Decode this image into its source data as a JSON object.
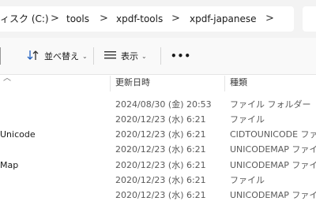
{
  "address": {
    "crumbs": [
      "ィスク (C:)",
      "tools",
      "xpdf-tools",
      "xpdf-japanese"
    ],
    "separator": ">"
  },
  "toolbar": {
    "sort_label": "並べ替え",
    "view_label": "表示",
    "more_label": "•••"
  },
  "columns": {
    "date": "更新日時",
    "type": "種類"
  },
  "rows": [
    {
      "name": "",
      "date": "2024/08/30 (金) 20:53",
      "type": "ファイル フォルダー"
    },
    {
      "name": "",
      "date": "2020/12/23 (水) 6:21",
      "type": "ファイル"
    },
    {
      "name": "Unicode",
      "date": "2020/12/23 (水) 6:21",
      "type": "CIDTOUNICODE ファイ..."
    },
    {
      "name": "",
      "date": "2020/12/23 (水) 6:21",
      "type": "UNICODEMAP ファイル"
    },
    {
      "name": "Map",
      "date": "2020/12/23 (水) 6:21",
      "type": "UNICODEMAP ファイル"
    },
    {
      "name": "",
      "date": "2020/12/23 (水) 6:21",
      "type": "ファイル"
    },
    {
      "name": "",
      "date": "2020/12/23 (水) 6:21",
      "type": "UNICODEMAP ファイル"
    }
  ]
}
